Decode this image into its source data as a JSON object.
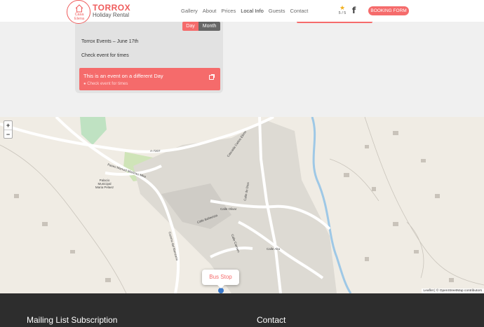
{
  "brand": {
    "logo_line1": "Casa",
    "logo_line2": "Elena",
    "name": "TORROX",
    "tagline": "Holiday Rental"
  },
  "nav": {
    "items": [
      {
        "label": "Gallery"
      },
      {
        "label": "About"
      },
      {
        "label": "Prices"
      },
      {
        "label": "Local Info"
      },
      {
        "label": "Guests"
      },
      {
        "label": "Contact"
      }
    ],
    "active": "Local Info"
  },
  "rating": {
    "text": "5 / 5"
  },
  "facebook_icon": "f",
  "booking_label": "BOOKING FORM",
  "calendar": {
    "day_label": "Day",
    "month_label": "Month",
    "event_title": "Torrox Events – June 17th",
    "event_times": "Check event for times",
    "card_title": "This is an event on a different Day",
    "card_subtitle": "● Check event for times"
  },
  "map": {
    "zoom_in": "+",
    "zoom_out": "−",
    "popup": "Bus Stop",
    "attribution": "Leaflet | © OpenStreetMap contributors",
    "labels": [
      {
        "text": "A-7207"
      },
      {
        "text": "Paseo Manuel Martinez Mira"
      },
      {
        "text": "Palacio Municipal Maria Pelaez"
      },
      {
        "text": "Calle Olivar"
      },
      {
        "text": "Calle Bellavista"
      },
      {
        "text": "Calle Alta"
      },
      {
        "text": "Cascada Carlos Eleno"
      },
      {
        "text": "Calle de Dios"
      },
      {
        "text": "Camino del Manzano"
      },
      {
        "text": "Calle Carmen"
      }
    ]
  },
  "colors": {
    "accent": "#f56b6b",
    "footer": "#2d2d2d",
    "map_land": "#f0ece4",
    "river": "#9ec8e6"
  },
  "footer": {
    "mailing": "Mailing List Subscription",
    "contact": "Contact"
  }
}
